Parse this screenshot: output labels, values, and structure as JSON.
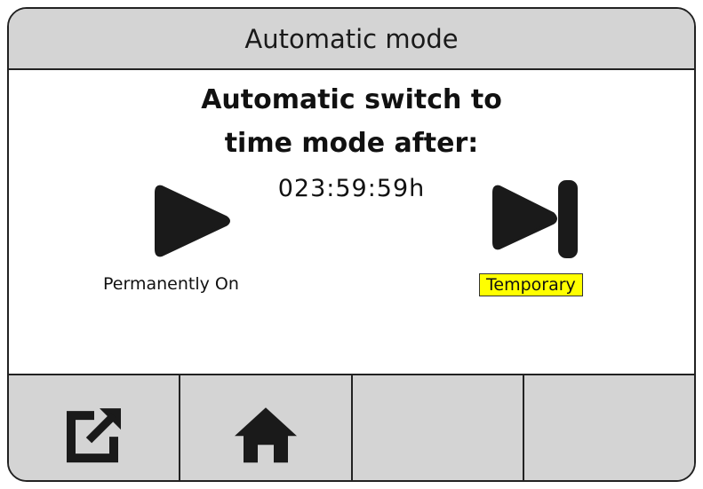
{
  "header": {
    "title": "Automatic mode"
  },
  "main": {
    "heading_line1": "Automatic switch to",
    "heading_line2": "time mode after:",
    "countdown": "023:59:59h",
    "options": [
      {
        "label": "Permanently On",
        "icon": "play-icon",
        "selected": false
      },
      {
        "label": "Temporary",
        "icon": "skip-next-icon",
        "selected": true
      }
    ]
  },
  "toolbar": {
    "buttons": [
      {
        "icon": "external-link-icon"
      },
      {
        "icon": "home-icon"
      },
      {
        "icon": ""
      },
      {
        "icon": ""
      }
    ]
  },
  "colors": {
    "selected_highlight": "#ffff00",
    "bar_background": "#d4d4d4",
    "icon_fill": "#1a1a1a"
  }
}
